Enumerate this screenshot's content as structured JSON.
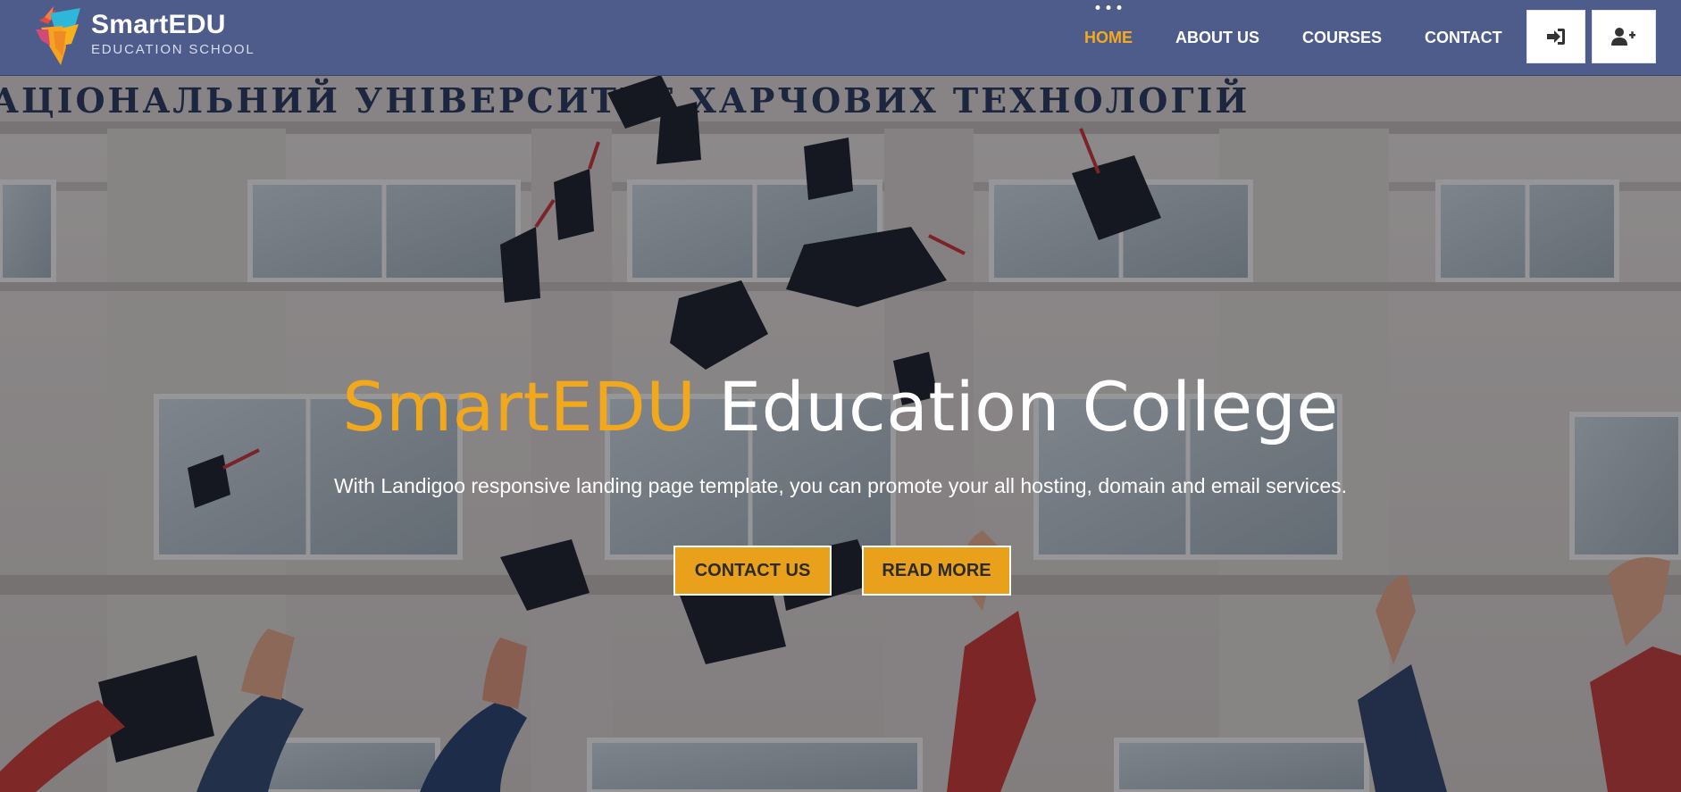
{
  "brand": {
    "name": "SmartEDU",
    "tagline": "EDUCATION SCHOOL"
  },
  "nav": {
    "items": [
      {
        "label": "HOME",
        "active": true
      },
      {
        "label": "ABOUT US",
        "active": false
      },
      {
        "label": "COURSES",
        "active": false
      },
      {
        "label": "CONTACT",
        "active": false
      }
    ],
    "login_icon": "sign-in-icon",
    "register_icon": "user-plus-icon"
  },
  "hero": {
    "title_accent": "SmartEDU",
    "title_rest": "Education College",
    "subtitle": "With Landigoo responsive landing page template, you can promote your all hosting, domain and email services.",
    "background_signage": "АЦІОНАЛЬНИЙ УНІВЕРСИТЕТ ХАРЧОВИХ ТЕХНОЛОГІЙ",
    "buttons": {
      "contact": "CONTACT US",
      "read_more": "READ MORE"
    }
  },
  "colors": {
    "header_bg": "#4e5c8c",
    "accent": "#f2a81d",
    "button_bg": "#e9a01b"
  }
}
